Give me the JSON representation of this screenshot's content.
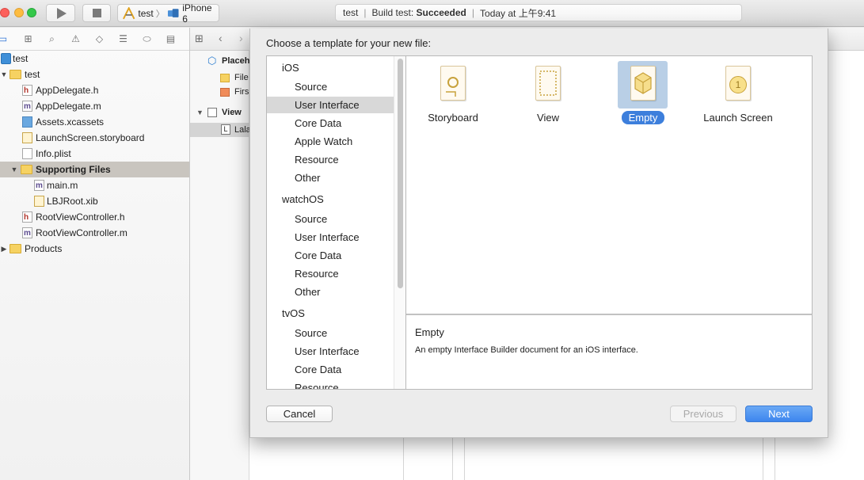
{
  "toolbar": {
    "scheme_target": "test",
    "scheme_device": "iPhone 6",
    "activity": {
      "project": "test",
      "status_prefix": "Build test:",
      "status_value": "Succeeded",
      "time": "Today at 上午9:41"
    }
  },
  "navigator": {
    "items": [
      {
        "label": "test",
        "icon": "project-icon"
      },
      {
        "label": "test",
        "icon": "folder-icon"
      },
      {
        "label": "AppDelegate.h",
        "icon": "header-file-icon",
        "letter": "h"
      },
      {
        "label": "AppDelegate.m",
        "icon": "source-file-icon",
        "letter": "m"
      },
      {
        "label": "Assets.xcassets",
        "icon": "asset-catalog-icon"
      },
      {
        "label": "LaunchScreen.storyboard",
        "icon": "storyboard-icon"
      },
      {
        "label": "Info.plist",
        "icon": "plist-icon"
      },
      {
        "label": "Supporting Files",
        "icon": "folder-icon"
      },
      {
        "label": "main.m",
        "icon": "source-file-icon",
        "letter": "m"
      },
      {
        "label": "LBJRoot.xib",
        "icon": "xib-icon"
      },
      {
        "label": "RootViewController.h",
        "icon": "header-file-icon",
        "letter": "h"
      },
      {
        "label": "RootViewController.m",
        "icon": "source-file-icon",
        "letter": "m"
      },
      {
        "label": "Products",
        "icon": "folder-icon"
      }
    ]
  },
  "outline": {
    "placeholders": "Placeh",
    "file_owner": "File",
    "first_responder": "Firs",
    "view": "View",
    "label": "Lala",
    "label_letter": "L"
  },
  "sheet": {
    "title": "Choose a template for your new file:",
    "categories": [
      {
        "label": "iOS",
        "kind": "platform"
      },
      {
        "label": "Source",
        "kind": "item"
      },
      {
        "label": "User Interface",
        "kind": "item",
        "selected": true
      },
      {
        "label": "Core Data",
        "kind": "item"
      },
      {
        "label": "Apple Watch",
        "kind": "item"
      },
      {
        "label": "Resource",
        "kind": "item"
      },
      {
        "label": "Other",
        "kind": "item"
      },
      {
        "label": "watchOS",
        "kind": "platform"
      },
      {
        "label": "Source",
        "kind": "item"
      },
      {
        "label": "User Interface",
        "kind": "item"
      },
      {
        "label": "Core Data",
        "kind": "item"
      },
      {
        "label": "Resource",
        "kind": "item"
      },
      {
        "label": "Other",
        "kind": "item"
      },
      {
        "label": "tvOS",
        "kind": "platform"
      },
      {
        "label": "Source",
        "kind": "item"
      },
      {
        "label": "User Interface",
        "kind": "item"
      },
      {
        "label": "Core Data",
        "kind": "item"
      },
      {
        "label": "Resource",
        "kind": "item"
      }
    ],
    "templates": [
      {
        "label": "Storyboard",
        "icon": "storyboard-template-icon"
      },
      {
        "label": "View",
        "icon": "view-template-icon"
      },
      {
        "label": "Empty",
        "icon": "empty-template-icon",
        "selected": true
      },
      {
        "label": "Launch Screen",
        "icon": "launch-screen-template-icon",
        "badge": "1"
      }
    ],
    "description": {
      "title": "Empty",
      "text": "An empty Interface Builder document for an iOS interface."
    },
    "buttons": {
      "cancel": "Cancel",
      "previous": "Previous",
      "next": "Next"
    }
  },
  "colors": {
    "accent": "#3d86ee",
    "selection": "#b9cfe6",
    "folder": "#f6d262"
  }
}
